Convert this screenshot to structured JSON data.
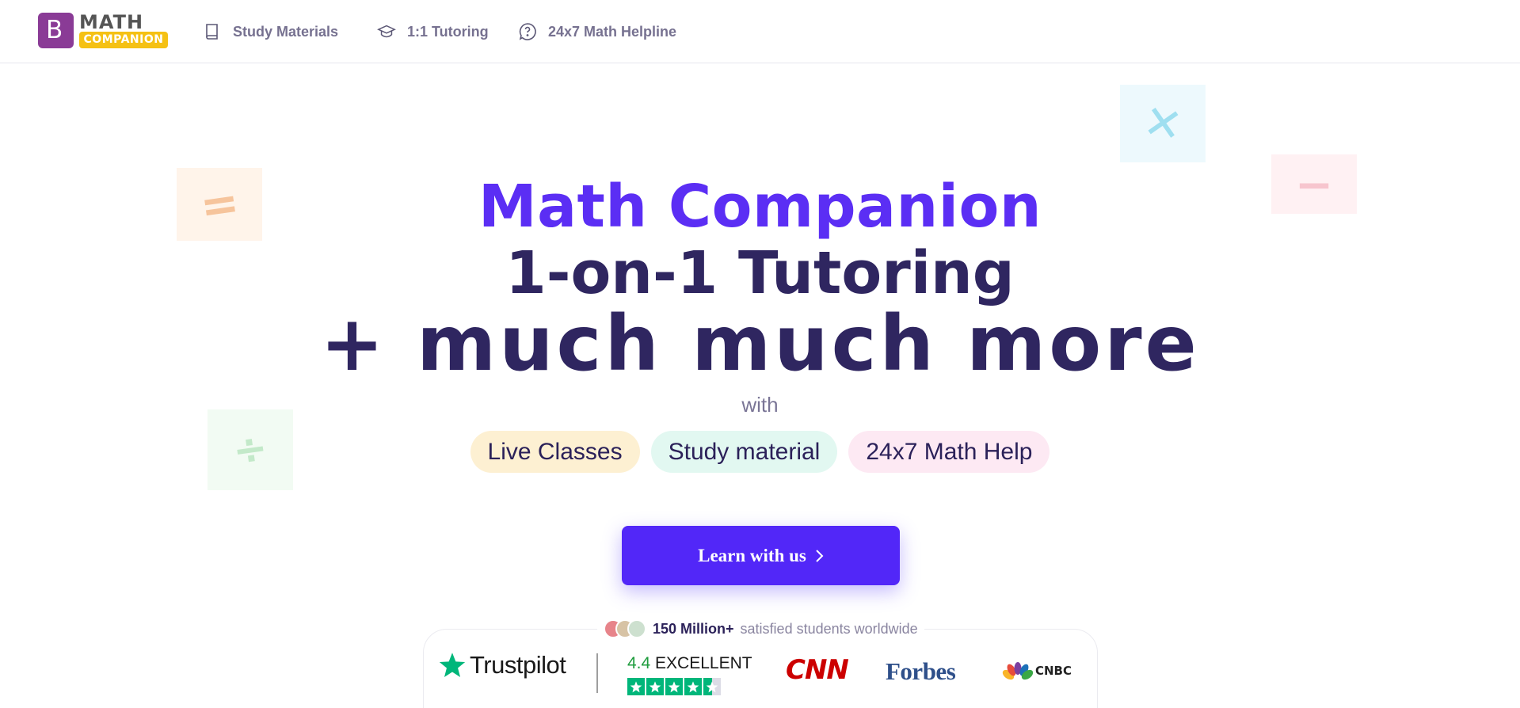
{
  "nav": {
    "logo": {
      "top": "MATH",
      "bottom": "COMPANION",
      "mark": "B"
    },
    "items": [
      {
        "label": "Study Materials",
        "icon": "book-icon"
      },
      {
        "label": "1:1 Tutoring",
        "icon": "graduation-cap-icon"
      },
      {
        "label": "24x7 Math Helpline",
        "icon": "help-bubble-icon"
      }
    ]
  },
  "decor": {
    "eq": "=",
    "times": "✕",
    "minus": "−",
    "divide": "÷"
  },
  "hero": {
    "title_line1": "Math Companion",
    "title_line2": "1-on-1 Tutoring",
    "title_line3": "+ much much more",
    "with": "with",
    "pills": [
      "Live Classes",
      "Study material",
      "24x7 Math Help"
    ],
    "cta_label": "Learn with us"
  },
  "trust": {
    "students_count": "150 Million+",
    "students_text": "satisfied students worldwide",
    "trustpilot_name": "Trustpilot",
    "rating_score": "4.4",
    "rating_label": "EXCELLENT",
    "stars": 4.4,
    "press": {
      "cnn": "CNN",
      "forbes": "Forbes",
      "cnbc": "CNBC"
    }
  },
  "colors": {
    "brand_purple": "#5b2ef4",
    "dark_text": "#2f2660",
    "cta": "#5227f8",
    "trustpilot_green": "#00b67a"
  }
}
